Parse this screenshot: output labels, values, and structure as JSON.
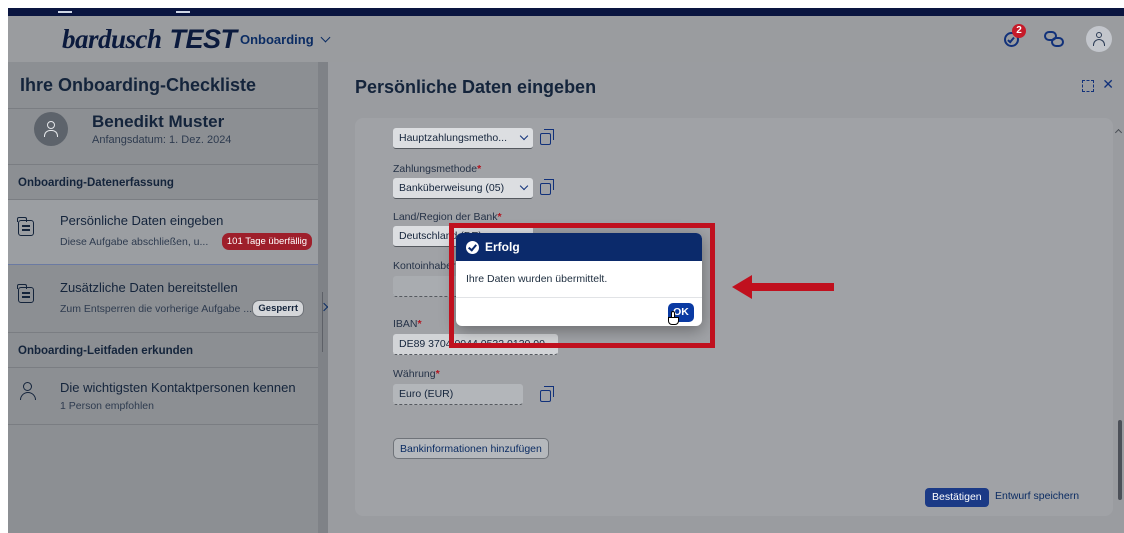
{
  "shell": {
    "logo_text": "bardusch",
    "logo_suffix": "TEST",
    "product_menu": "Onboarding",
    "notification_count": "2",
    "icons": [
      "notifications-icon",
      "chat-icon",
      "user-avatar-icon"
    ]
  },
  "left_panel": {
    "title": "Ihre Onboarding-Checkliste",
    "profile": {
      "name": "Benedikt Muster",
      "start_date": "Anfangsdatum: 1. Dez. 2024"
    },
    "sections": [
      {
        "heading": "Onboarding-Datenerfassung",
        "tasks": [
          {
            "title": "Persönliche Daten eingeben",
            "subtitle": "Diese Aufgabe abschließen, u...",
            "badge": "101 Tage überfällig",
            "selected": true
          },
          {
            "title": "Zusätzliche Daten bereitstellen",
            "subtitle": "Zum Entsperren die vorherige Aufgabe ...",
            "badge": "Gesperrt",
            "selected": false
          }
        ]
      },
      {
        "heading": "Onboarding-Leitfaden erkunden",
        "tasks": [
          {
            "title": "Die wichtigsten Kontaktpersonen kennen",
            "subtitle": "1 Person empfohlen"
          }
        ]
      }
    ]
  },
  "detail": {
    "title": "Persönliche Daten eingeben",
    "fields": {
      "payment_type": {
        "value": "Hauptzahlungsmetho..."
      },
      "payment_method": {
        "label": "Zahlungsmethode",
        "value": "Banküberweisung (05)"
      },
      "bank_country": {
        "label": "Land/Region der Bank",
        "value": "Deutschland (DE)"
      },
      "account_holder": {
        "label": "Kontoinhaber",
        "value": ""
      },
      "iban": {
        "label": "IBAN",
        "value": "DE89 3704 0044 0532 0130 00"
      },
      "currency": {
        "label": "Währung",
        "value": "Euro (EUR)"
      }
    },
    "add_bank_button": "Bankinformationen hinzufügen",
    "confirm_button": "Bestätigen",
    "save_draft_button": "Entwurf speichern"
  },
  "dialog": {
    "title": "Erfolg",
    "message": "Ihre Daten wurden übermittelt.",
    "ok_button": "OK"
  },
  "annotation": {
    "color": "#c0101e"
  }
}
